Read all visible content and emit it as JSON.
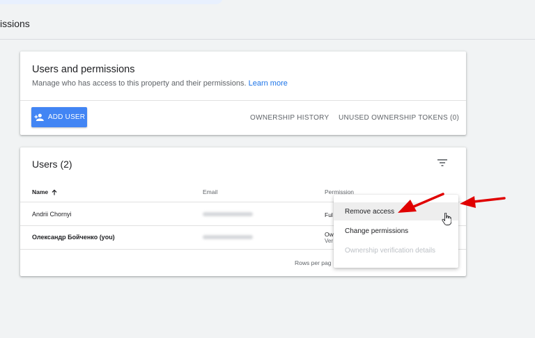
{
  "page": {
    "title": "issions"
  },
  "users_card": {
    "title": "Users and permissions",
    "subtitle": "Manage who has access to this property and their permissions.",
    "learn_more": "Learn more",
    "add_user_label": "ADD USER",
    "ownership_history_label": "OWNERSHIP HISTORY",
    "unused_tokens_label": "UNUSED OWNERSHIP TOKENS (0)"
  },
  "users_table": {
    "title": "Users (2)",
    "columns": {
      "name": "Name",
      "email": "Email",
      "permission": "Permission"
    },
    "rows": [
      {
        "name": "Andrii Chornyi",
        "permission": "Ful",
        "permission_sub": ""
      },
      {
        "name": "Олександр Бойченко (you)",
        "permission": "Ow",
        "permission_sub": "Ver"
      }
    ],
    "rows_per_page": "Rows per pag"
  },
  "context_menu": {
    "items": [
      {
        "label": "Remove access"
      },
      {
        "label": "Change permissions"
      },
      {
        "label": "Ownership verification details"
      }
    ]
  },
  "colors": {
    "accent": "#4285f4",
    "link": "#1a73e8",
    "arrow": "#e00000"
  },
  "icons": [
    "add-person-icon",
    "sort-arrow-up-icon",
    "filter-icon",
    "hand-pointer-icon"
  ]
}
